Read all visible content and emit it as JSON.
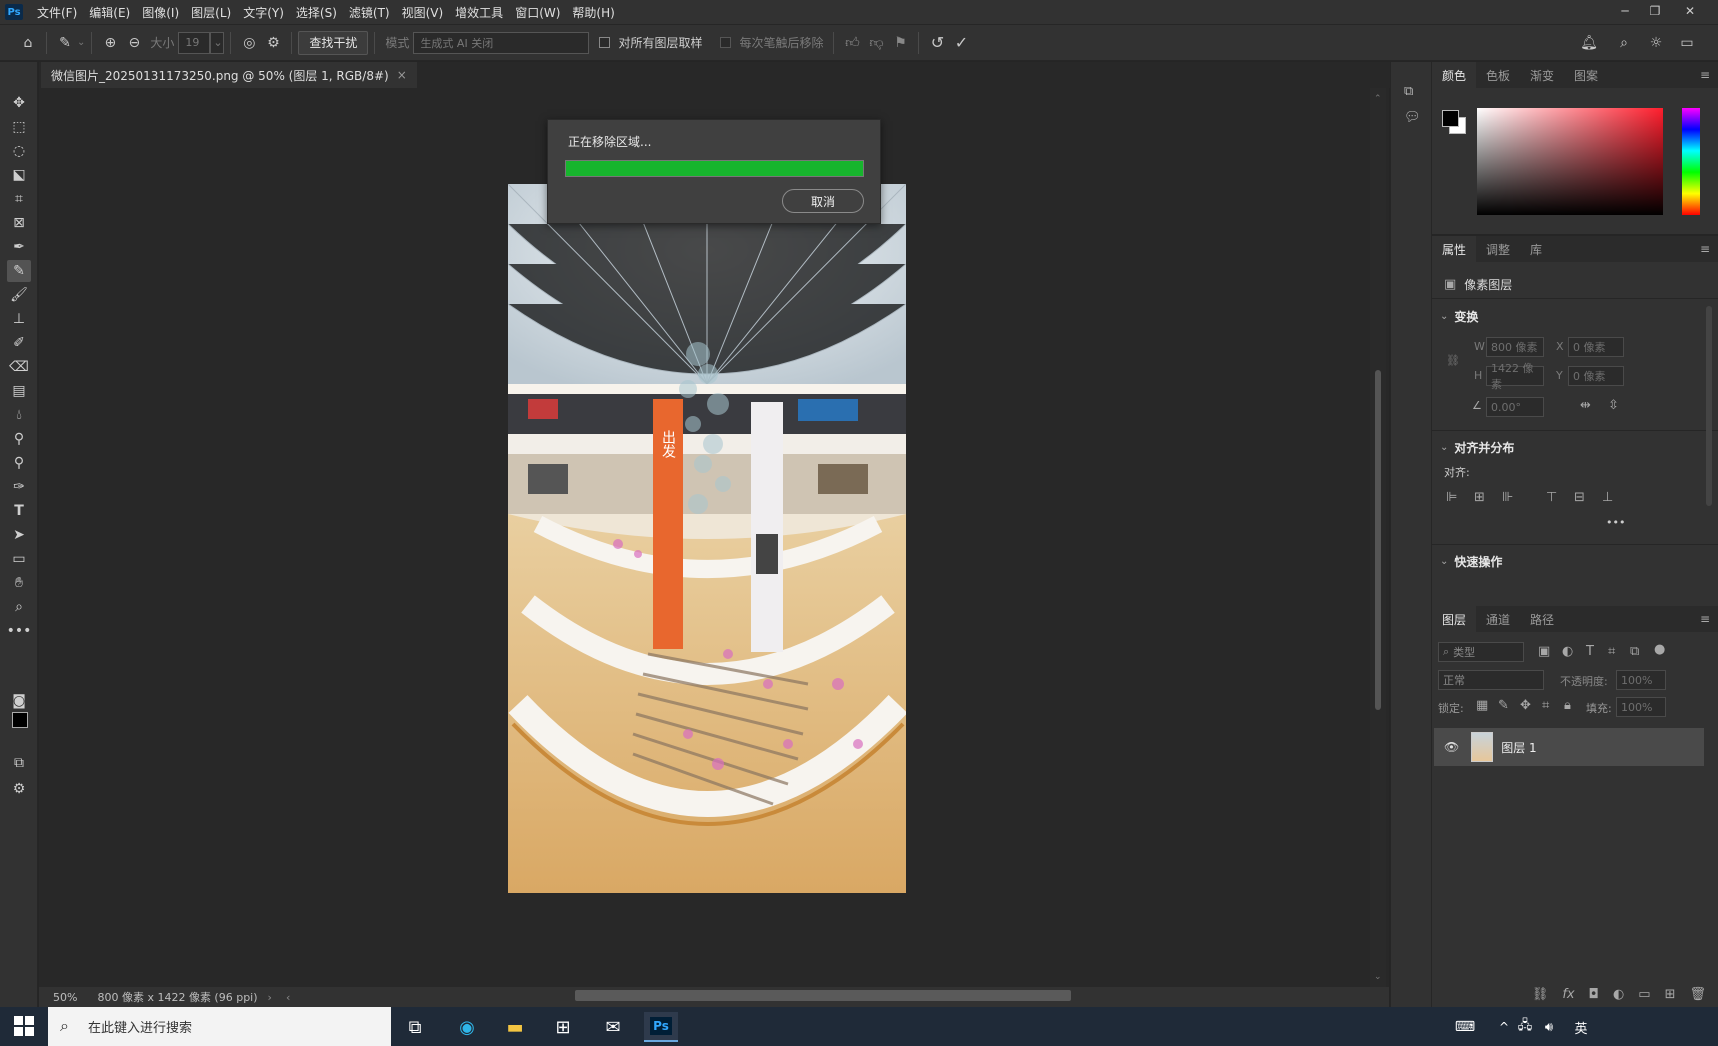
{
  "menubar": {
    "logo": "Ps",
    "items": [
      "文件(F)",
      "编辑(E)",
      "图像(I)",
      "图层(L)",
      "文字(Y)",
      "选择(S)",
      "滤镜(T)",
      "视图(V)",
      "增效工具",
      "窗口(W)",
      "帮助(H)"
    ],
    "window_controls": [
      "─",
      "❐",
      "✕"
    ]
  },
  "options": {
    "size_label": "大小",
    "size_value": "19",
    "find_distractions": "查找干扰",
    "mode_label": "模式",
    "mode_value": "生成式 AI 关闭",
    "sample_all_layers": "对所有图层取样",
    "remove_after_stroke": "每次笔触后移除"
  },
  "document": {
    "tab_title": "微信图片_20250131173250.png @ 50% (图层 1, RGB/8#)",
    "close": "×",
    "zoom": "50%",
    "info": "800 像素 x 1422 像素 (96 ppi)"
  },
  "dialog": {
    "title": "正在移除区域...",
    "progress_fraction": 1.0,
    "progress_color": "#17b52d",
    "cancel": "取消"
  },
  "color_panel": {
    "tabs": [
      "颜色",
      "色板",
      "渐变",
      "图案"
    ],
    "foreground": "#000000",
    "background": "#ffffff",
    "hue_color": "#ff1e2d"
  },
  "properties_panel": {
    "tabs": [
      "属性",
      "调整",
      "库"
    ],
    "layer_type": "像素图层",
    "transform_title": "变换",
    "w_label": "W",
    "w_value": "800 像素",
    "x_label": "X",
    "x_value": "0 像素",
    "h_label": "H",
    "h_value": "1422 像素",
    "y_label": "Y",
    "y_value": "0 像素",
    "angle_value": "0.00°",
    "align_title": "对齐并分布",
    "align_label": "对齐:",
    "more": "•••",
    "quick_actions": "快速操作"
  },
  "layers_panel": {
    "tabs": [
      "图层",
      "通道",
      "路径"
    ],
    "filter_placeholder": "类型",
    "blend_mode": "正常",
    "opacity_label": "不透明度:",
    "opacity_value": "100%",
    "lock_label": "锁定:",
    "fill_label": "填充:",
    "fill_value": "100%",
    "layers": [
      {
        "name": "图层 1",
        "visible": true
      }
    ]
  },
  "taskbar": {
    "search_placeholder": "在此键入进行搜索",
    "ime": "英",
    "ps_label": "Ps"
  }
}
